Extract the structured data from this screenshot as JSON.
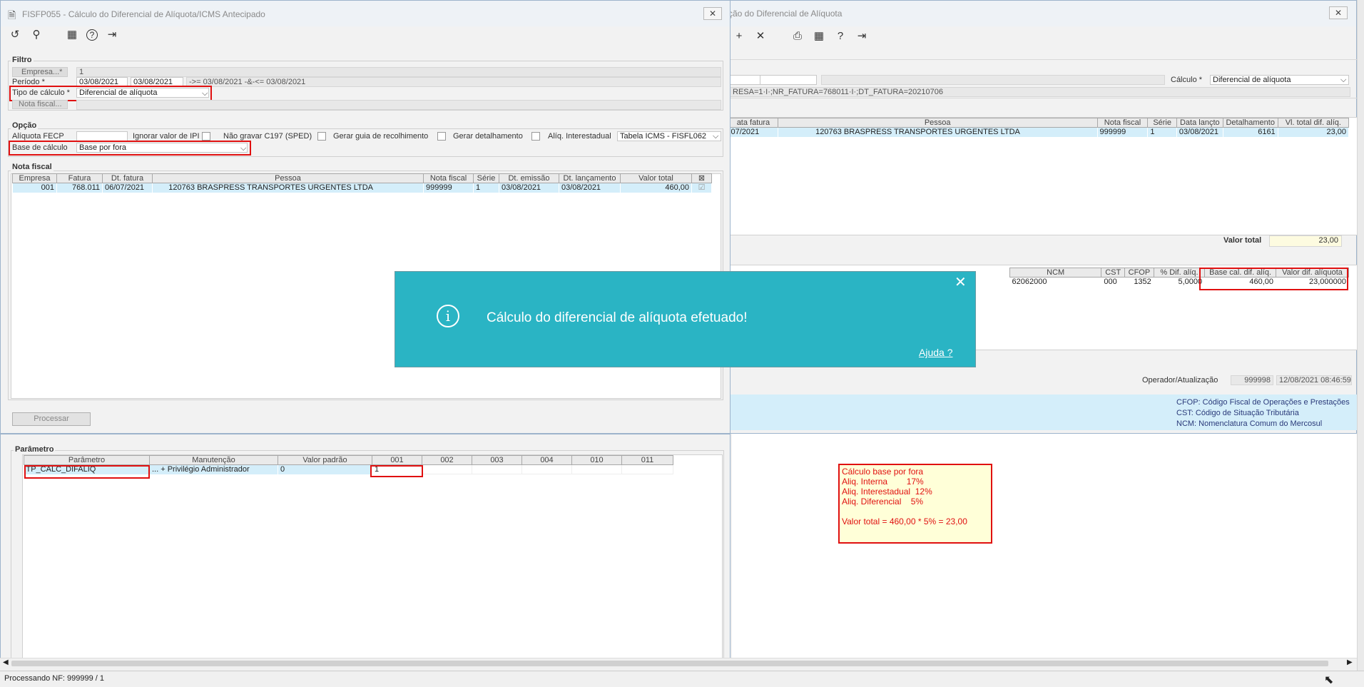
{
  "front": {
    "title": "FISFP055 - Cálculo do Diferencial de Alíquota/ICMS Antecipado",
    "close": "✕",
    "toolbar": {
      "undo": "↺",
      "search": "⚲",
      "calendar": "▦",
      "help": "?",
      "exit": "⇥"
    },
    "filtro": {
      "legend": "Filtro",
      "empresa_label": "Empresa...*",
      "empresa_value": "1",
      "periodo_label": "Período *",
      "periodo_from": "03/08/2021",
      "periodo_to": "03/08/2021",
      "periodo_desc": "->= 03/08/2021 -&-<= 03/08/2021",
      "tipo_label": "Tipo de cálculo *",
      "tipo_value": "Diferencial de alíquota",
      "nota_label": "Nota fiscal..."
    },
    "opcao": {
      "legend": "Opção",
      "fecp_label": "Alíquota FECP",
      "ignorar_ipi": "Ignorar valor de IPI",
      "nao_gravar": "Não gravar C197 (SPED)",
      "gerar_guia": "Gerar guia de recolhimento",
      "gerar_det": "Gerar detalhamento",
      "aliq_inter": "Alíq. Interestadual",
      "tabela": "Tabela ICMS - FISFL062",
      "base_label": "Base de cálculo",
      "base_value": "Base por fora"
    },
    "nota": {
      "legend": "Nota fiscal",
      "headers": [
        "Empresa",
        "Fatura",
        "Dt. fatura",
        "Pessoa",
        "Nota fiscal",
        "Série",
        "Dt. emissão",
        "Dt. lançamento",
        "Valor total"
      ],
      "row": {
        "empresa": "001",
        "fatura": "768.011",
        "dt_fatura": "06/07/2021",
        "pessoa_cod": "120763",
        "pessoa_nome": "BRASPRESS TRANSPORTES URGENTES LTDA",
        "nota": "999999",
        "serie": "1",
        "dt_emissao": "03/08/2021",
        "dt_lanc": "03/08/2021",
        "valor": "460,00"
      }
    },
    "processar": "Processar"
  },
  "back": {
    "title_part": "ção do Diferencial de Alíquota",
    "close": "✕",
    "calc_label": "Cálculo *",
    "calc_value": "Diferencial de alíquota",
    "filter_text": "RESA=1·I·;NR_FATURA=768011·I·;DT_FATURA=20210706",
    "headers1": [
      "ata fatura",
      "Pessoa",
      "Nota fiscal",
      "Série",
      "Data lançto",
      "Detalhamento",
      "Vl. total dif. alíq."
    ],
    "row1": {
      "data": "07/2021",
      "pessoa_cod": "120763",
      "pessoa_nome": "BRASPRESS TRANSPORTES URGENTES LTDA",
      "nota": "999999",
      "serie": "1",
      "data_lanc": "03/08/2021",
      "det": "6161",
      "total": "23,00"
    },
    "valor_total_label": "Valor total",
    "valor_total": "23,00",
    "headers2": [
      "NCM",
      "CST",
      "CFOP",
      "% Dif. alíq.",
      "Base cal. dif. alíq.",
      "Valor dif. alíquota"
    ],
    "row2": {
      "ncm": "62062000",
      "cst": "000",
      "cfop": "1352",
      "pct": "5,0000",
      "base": "460,00",
      "valor": "23,000000"
    },
    "operador_label": "Operador/Atualização",
    "operador": "999998",
    "data_atual": "12/08/2021 08:46:59",
    "legend": [
      "CFOP: Código Fiscal de Operações e Prestações",
      "CST: Código de Situação Tributária",
      "NCM: Nomenclatura Comum do Mercosul"
    ]
  },
  "param": {
    "legend": "Parâmetro",
    "headers": [
      "Parâmetro",
      "Manutenção",
      "Valor padrão",
      "001",
      "002",
      "003",
      "004",
      "010",
      "011"
    ],
    "row": {
      "param": "TP_CALC_DIFALIQ",
      "manut": "... + Privilégio Administrador",
      "valor": "0",
      "c001": "1"
    }
  },
  "toast": {
    "message": "Cálculo do diferencial de alíquota efetuado!",
    "help": "Ajuda ?",
    "close": "✕",
    "icon": "i"
  },
  "note": [
    "Cálculo base por fora",
    "Aliq. Interna        17%",
    "Aliq. Interestadual  12%",
    "Aliq. Diferencial    5%",
    "",
    "Valor total = 460,00 * 5% = 23,00"
  ],
  "status": "Processando NF: 999999 / 1",
  "colors": {
    "toast": "#2ab4c4",
    "highlight": "#e01010",
    "row": "#d4eefa"
  }
}
